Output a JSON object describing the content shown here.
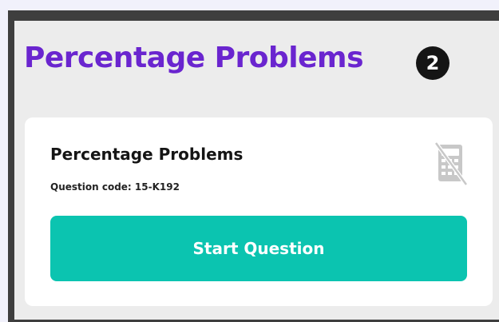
{
  "header": {
    "title": "Percentage Problems",
    "step_badge": "2"
  },
  "card": {
    "title": "Percentage Problems",
    "question_code": "Question code: 15-K192",
    "calculator_icon": "calculator-not-allowed-icon",
    "start_button_label": "Start Question"
  },
  "colors": {
    "title_purple": "#6a25cf",
    "button_teal": "#0bc4b0",
    "frame_dark": "#3e3e3e",
    "panel_gray": "#ececec",
    "icon_gray": "#c8c8c8"
  }
}
